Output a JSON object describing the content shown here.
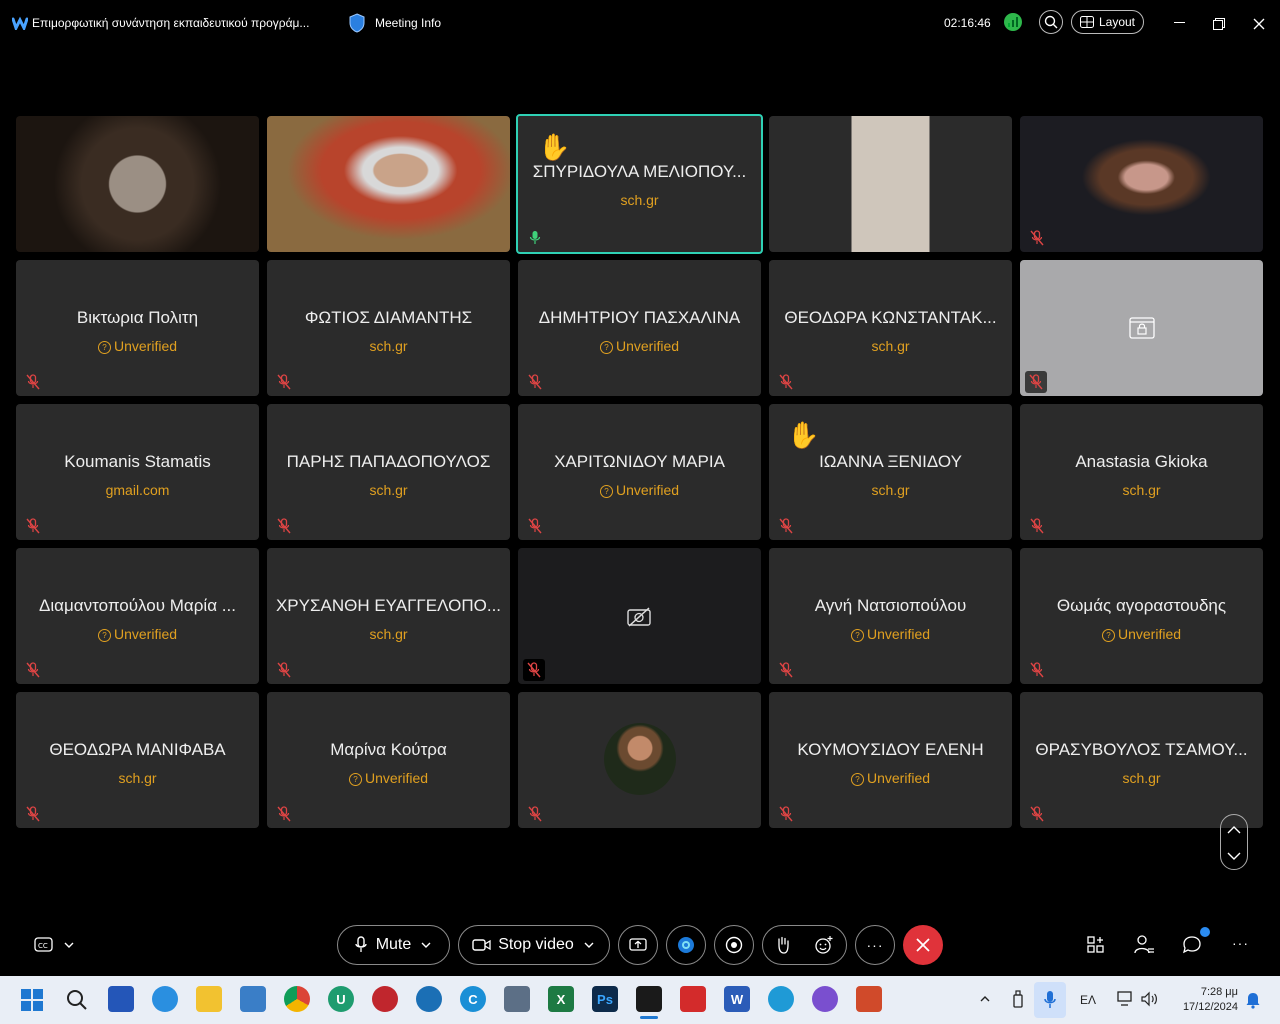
{
  "titlebar": {
    "meeting_title": "Επιμορφωτική συνάντηση εκπαιδευτικού προγράμ...",
    "meeting_info": "Meeting Info",
    "timer": "02:16:46",
    "layout_label": "Layout"
  },
  "tiles": [
    {
      "name": "",
      "sub": "",
      "kind": "video"
    },
    {
      "name": "",
      "sub": "",
      "kind": "video"
    },
    {
      "name": "ΣΠΥΡΙΔΟΥΛΑ ΜΕΛΙΟΠΟΥ...",
      "sub": "sch.gr",
      "kind": "active"
    },
    {
      "name": "",
      "sub": "",
      "kind": "video"
    },
    {
      "name": "",
      "sub": "",
      "kind": "video"
    },
    {
      "name": "Βικτωρια Πολιτη",
      "sub": "Unverified"
    },
    {
      "name": "ΦΩΤΙΟΣ ΔΙΑΜΑΝΤΗΣ",
      "sub": "sch.gr"
    },
    {
      "name": "ΔΗΜΗΤΡΙΟΥ ΠΑΣΧΑΛΙΝΑ",
      "sub": "Unverified"
    },
    {
      "name": "ΘΕΟΔΩΡΑ ΚΩΝΣΤΑΝΤΑΚ...",
      "sub": "sch.gr"
    },
    {
      "name": "",
      "sub": "",
      "kind": "locked"
    },
    {
      "name": "Koumanis Stamatis",
      "sub": "gmail.com"
    },
    {
      "name": "ΠΑΡΗΣ ΠΑΠΑΔΟΠΟΥΛΟΣ",
      "sub": "sch.gr"
    },
    {
      "name": "ΧΑΡΙΤΩΝΙΔΟΥ ΜΑΡΙΑ",
      "sub": "Unverified"
    },
    {
      "name": "ΙΩΑΝΝΑ ΞΕΝΙΔΟΥ",
      "sub": "sch.gr",
      "hand": true
    },
    {
      "name": "Anastasia Gkioka",
      "sub": "sch.gr"
    },
    {
      "name": "Διαμαντοπούλου Μαρία ...",
      "sub": "Unverified"
    },
    {
      "name": "ΧΡΥΣΑΝΘΗ ΕΥΑΓΓΕΛΟΠΟ...",
      "sub": "sch.gr"
    },
    {
      "name": "",
      "sub": "",
      "kind": "camoff"
    },
    {
      "name": "Αγνή Νατσιοπούλου",
      "sub": "Unverified"
    },
    {
      "name": "Θωμάς αγοραστουδης",
      "sub": "Unverified"
    },
    {
      "name": "ΘΕΟΔΩΡΑ ΜΑΝΙΦΑΒΑ",
      "sub": "sch.gr"
    },
    {
      "name": "Μαρίνα Κούτρα",
      "sub": "Unverified"
    },
    {
      "name": "",
      "sub": "",
      "kind": "avatar"
    },
    {
      "name": "ΚΟΥΜΟΥΣΙΔΟΥ ΕΛΕΝΗ",
      "sub": "Unverified"
    },
    {
      "name": "ΘΡΑΣΥΒΟΥΛΟΣ ΤΣΑΜΟΥ...",
      "sub": "sch.gr"
    }
  ],
  "toolbar": {
    "mute_label": "Mute",
    "stop_video_label": "Stop video",
    "more_label": "···"
  },
  "taskbar": {
    "language": "ΕΛ",
    "time": "7:28 μμ",
    "date": "17/12/2024"
  },
  "colors": {
    "accent_green": "#2ecc71",
    "unverified": "#e0a020",
    "leave_red": "#e0333a",
    "active_border": "#2fd1b5"
  }
}
